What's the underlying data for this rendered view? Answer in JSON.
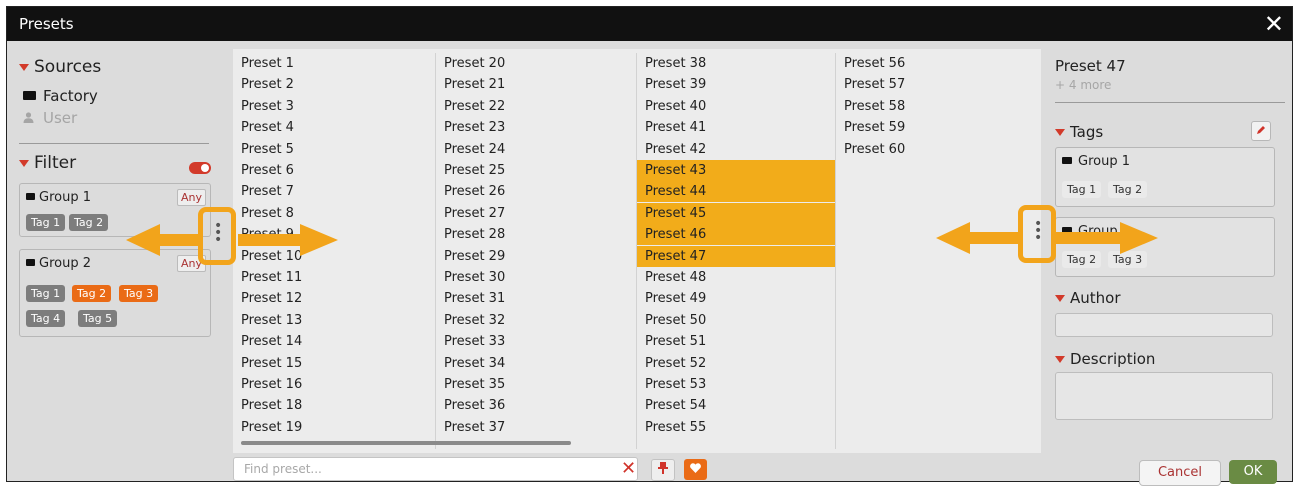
{
  "window": {
    "title": "Presets",
    "close_glyph": "✕"
  },
  "sources": {
    "heading": "Sources",
    "items": [
      {
        "label": "Factory",
        "icon": "folder-icon"
      },
      {
        "label": "User",
        "icon": "user-icon"
      }
    ]
  },
  "filter": {
    "heading": "Filter",
    "groups": [
      {
        "title": "Group 1",
        "any_label": "Any",
        "tags": [
          {
            "label": "Tag 1",
            "active": false
          },
          {
            "label": "Tag 2",
            "active": false
          }
        ]
      },
      {
        "title": "Group 2",
        "any_label": "Any",
        "tags": [
          {
            "label": "Tag 1",
            "active": false
          },
          {
            "label": "Tag 2",
            "active": true
          },
          {
            "label": "Tag 3",
            "active": true
          },
          {
            "label": "Tag 4",
            "active": false
          },
          {
            "label": "Tag 5",
            "active": false
          }
        ]
      }
    ]
  },
  "presets": {
    "columns": [
      [
        "Preset 1",
        "Preset 2",
        "Preset 3",
        "Preset 4",
        "Preset 5",
        "Preset 6",
        "Preset 7",
        "Preset 8",
        "Preset 9",
        "Preset 10",
        "Preset 11",
        "Preset 12",
        "Preset 13",
        "Preset 14",
        "Preset 15",
        "Preset 16",
        "Preset 18",
        "Preset 19"
      ],
      [
        "Preset 20",
        "Preset 21",
        "Preset 22",
        "Preset 23",
        "Preset 24",
        "Preset 25",
        "Preset 26",
        "Preset 27",
        "Preset 28",
        "Preset 29",
        "Preset 30",
        "Preset 31",
        "Preset 32",
        "Preset 33",
        "Preset 34",
        "Preset 35",
        "Preset 36",
        "Preset 37"
      ],
      [
        "Preset 38",
        "Preset 39",
        "Preset 40",
        "Preset 41",
        "Preset 42",
        "Preset 43",
        "Preset 44",
        "Preset 45",
        "Preset 46",
        "Preset 47",
        "Preset 48",
        "Preset 49",
        "Preset 50",
        "Preset 51",
        "Preset 52",
        "Preset 53",
        "Preset 54",
        "Preset 55"
      ],
      [
        "Preset 56",
        "Preset 57",
        "Preset 58",
        "Preset 59",
        "Preset 60"
      ]
    ],
    "selected": [
      "Preset 43",
      "Preset 44",
      "Preset 45",
      "Preset 46",
      "Preset 47"
    ]
  },
  "search": {
    "placeholder": "Find preset...",
    "value": "",
    "clear_glyph": "✕"
  },
  "footer": {
    "cancel_label": "Cancel",
    "ok_label": "OK"
  },
  "details": {
    "title": "Preset 47",
    "subtitle": "+ 4 more",
    "tags_heading": "Tags",
    "groups": [
      {
        "title": "Group 1",
        "tags": [
          "Tag 1",
          "Tag 2"
        ]
      },
      {
        "title": "Group 2",
        "tags": [
          "Tag 2",
          "Tag 3"
        ]
      }
    ],
    "author_heading": "Author",
    "author_value": "",
    "description_heading": "Description",
    "description_value": ""
  },
  "colors": {
    "accent": "#ea6b16",
    "selection": "#f2ac1a",
    "highlight_annotation": "#f2a41b",
    "ok": "#6a8b44"
  }
}
